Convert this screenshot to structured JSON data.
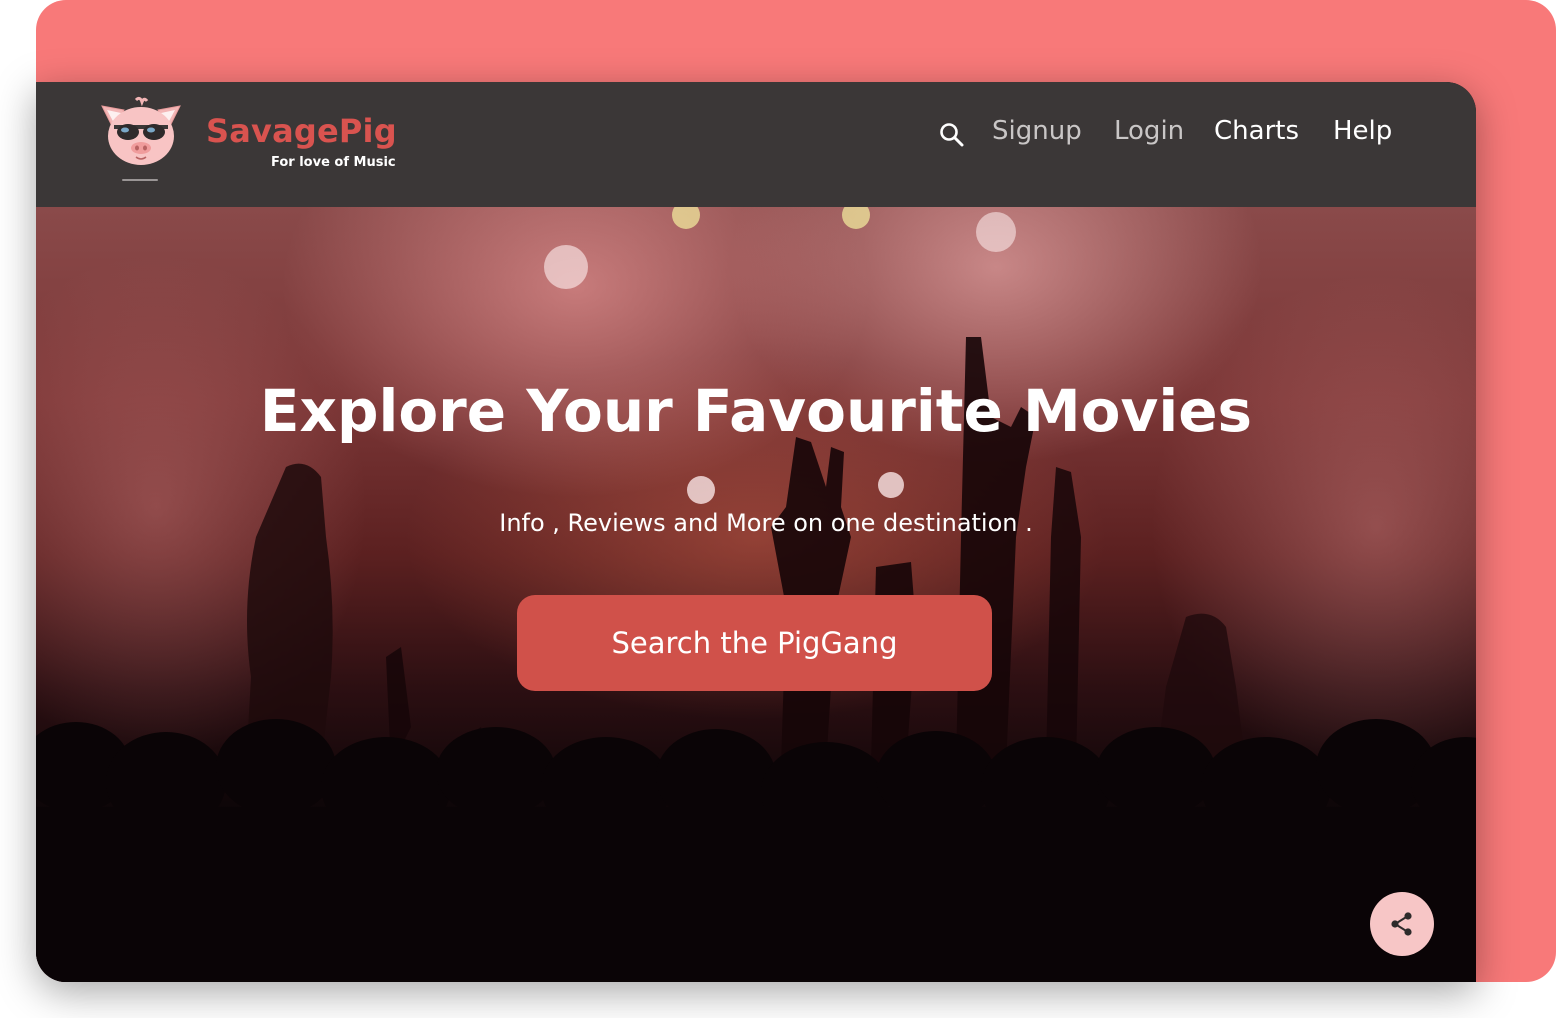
{
  "brand": {
    "name": "SavagePig",
    "tagline": "For love of Music",
    "logo_icon": "pig-with-sunglasses-icon"
  },
  "nav": {
    "search_icon": "search-icon",
    "items": [
      {
        "label": "Signup",
        "style": "muted"
      },
      {
        "label": "Login",
        "style": "muted"
      },
      {
        "label": "Charts",
        "style": "active"
      },
      {
        "label": "Help",
        "style": "active"
      }
    ]
  },
  "hero": {
    "title": "Explore Your Favourite Movies",
    "subtitle": "Info , Reviews and More on one destination .",
    "cta_label": "Search the PigGang"
  },
  "share": {
    "icon": "share-icon"
  },
  "colors": {
    "backdrop": "#f87979",
    "navbar": "#3b3737",
    "brand": "#d9534f",
    "cta": "#d0514a",
    "share_bg": "#f7c6c6"
  }
}
